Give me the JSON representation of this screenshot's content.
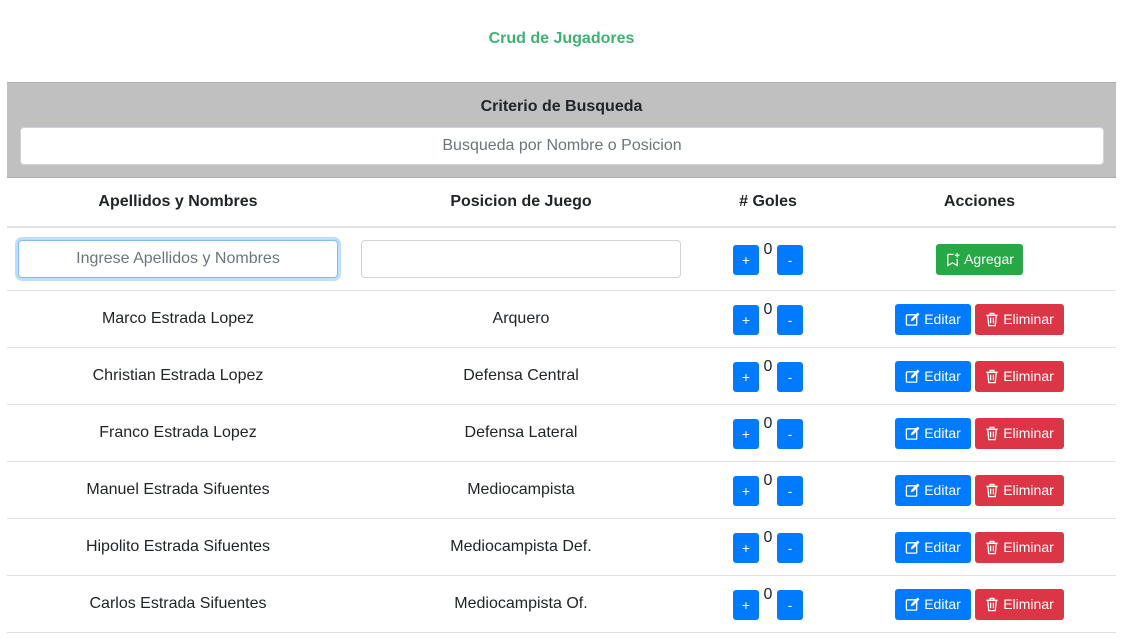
{
  "page": {
    "title": "Crud de Jugadores"
  },
  "search": {
    "label": "Criterio de Busqueda",
    "placeholder": "Busqueda por Nombre o Posicion",
    "value": ""
  },
  "table": {
    "headers": {
      "name": "Apellidos y Nombres",
      "position": "Posicion de Juego",
      "goals": "# Goles",
      "actions": "Acciones"
    },
    "new_row": {
      "name_placeholder": "Ingrese Apellidos y Nombres",
      "name_value": "",
      "position_value": "",
      "goals": "0",
      "add_label": "Agregar"
    },
    "rows": [
      {
        "name": "Marco Estrada Lopez",
        "position": "Arquero",
        "goals": "0"
      },
      {
        "name": "Christian Estrada Lopez",
        "position": "Defensa Central",
        "goals": "0"
      },
      {
        "name": "Franco Estrada Lopez",
        "position": "Defensa Lateral",
        "goals": "0"
      },
      {
        "name": "Manuel Estrada Sifuentes",
        "position": "Mediocampista",
        "goals": "0"
      },
      {
        "name": "Hipolito Estrada Sifuentes",
        "position": "Mediocampista Def.",
        "goals": "0"
      },
      {
        "name": "Carlos Estrada Sifuentes",
        "position": "Mediocampista Of.",
        "goals": "0"
      }
    ]
  },
  "buttons": {
    "increment": "+",
    "decrement": "-",
    "edit": "Editar",
    "delete": "Eliminar"
  },
  "icons": {
    "add": "bookmark-plus-icon",
    "edit": "pencil-square-icon",
    "delete": "trash-icon"
  },
  "colors": {
    "title": "#3cb371",
    "search_panel": "#c0c0c0",
    "primary": "#007bff",
    "success": "#28a745",
    "danger": "#dc3545"
  }
}
